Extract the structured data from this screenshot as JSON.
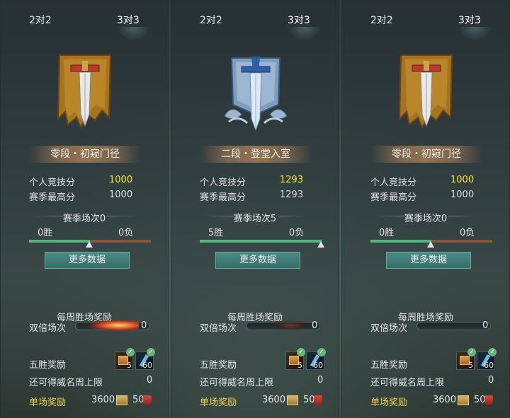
{
  "panels": [
    {
      "tab_2v2": "2对2",
      "tab_3v3": "3对3",
      "emblem": "gold-banner-sword-icon",
      "rank_title": "零段・初窥门径",
      "personal_score_label": "个人竞技分",
      "personal_score_value": "1000",
      "season_high_label": "赛季最高分",
      "season_high_value": "1000",
      "season_matches_label": "赛季场次0",
      "wins": "0胜",
      "losses": "0负",
      "win_fraction": 0.5,
      "more_data_button": "更多数据",
      "weekly_reward_label": "每周胜场奖励",
      "double_matches_label": "双倍场次",
      "double_matches_count": "0",
      "double_fire": true,
      "five_wins_label": "五胜奖励",
      "reward_chest_count": "5",
      "reward_scroll_count": "60",
      "remaining_label": "还可得威名周上限",
      "remaining_value": "0",
      "single_reward_label": "单场奖励",
      "single_coin": "3600",
      "single_shield": "50"
    },
    {
      "tab_2v2": "2对2",
      "tab_3v3": "3对3",
      "emblem": "silver-banner-sword-icon",
      "rank_title": "二段・登堂入室",
      "personal_score_label": "个人竞技分",
      "personal_score_value": "1293",
      "season_high_label": "赛季最高分",
      "season_high_value": "1293",
      "season_matches_label": "赛季场次5",
      "wins": "5胜",
      "losses": "0负",
      "win_fraction": 1.0,
      "more_data_button": "更多数据",
      "weekly_reward_label": "每周胜场奖励",
      "double_matches_label": "双倍场次",
      "double_matches_count": "0",
      "double_fire": false,
      "five_wins_label": "五胜奖励",
      "reward_chest_count": "5",
      "reward_scroll_count": "60",
      "remaining_label": "还可得威名周上限",
      "remaining_value": "0",
      "single_reward_label": "单场奖励",
      "single_coin": "3600",
      "single_shield": "50"
    },
    {
      "tab_2v2": "2对2",
      "tab_3v3": "3对3",
      "emblem": "gold-banner-sword-icon",
      "rank_title": "零段・初窥门径",
      "personal_score_label": "个人竞技分",
      "personal_score_value": "1000",
      "season_high_label": "赛季最高分",
      "season_high_value": "1000",
      "season_matches_label": "赛季场次0",
      "wins": "0胜",
      "losses": "0负",
      "win_fraction": 0.5,
      "more_data_button": "更多数据",
      "weekly_reward_label": "每周胜场奖励",
      "double_matches_label": "双倍场次",
      "double_matches_count": "0",
      "double_fire": false,
      "five_wins_label": "五胜奖励",
      "reward_chest_count": "5",
      "reward_scroll_count": "60",
      "remaining_label": "还可得威名周上限",
      "remaining_value": "0",
      "single_reward_label": "单场奖励",
      "single_coin": "3600",
      "single_shield": "50"
    }
  ],
  "colors": {
    "highlight_yellow": "#f4e63a",
    "single_reward_gold": "#f0d54c",
    "win_green": "#4fb77c",
    "loss_brown": "#8a5537",
    "button_teal": "#3f7c77"
  }
}
